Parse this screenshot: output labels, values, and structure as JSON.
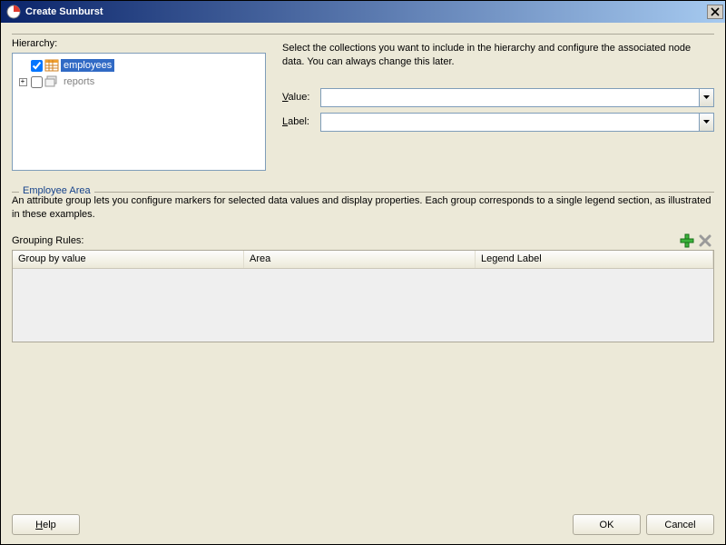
{
  "titlebar": {
    "title": "Create Sunburst"
  },
  "hierarchy": {
    "label": "Hierarchy:",
    "nodes": {
      "employees": "employees",
      "reports": "reports"
    }
  },
  "instruction": "Select the collections you want to include in the hierarchy and configure the associated node data. You can always change this later.",
  "fields": {
    "value_label": "Value:",
    "value_mn": "V",
    "label_label": "Label:",
    "label_mn": "L",
    "value_value": "",
    "label_value": ""
  },
  "employee_area": {
    "legend": "Employee Area",
    "desc": "An attribute group lets you configure markers for selected data values and display properties. Each group corresponds to a single legend section, as illustrated in these examples.",
    "rules_label": "Grouping Rules:",
    "columns": {
      "group_by": "Group by value",
      "area": "Area",
      "legend": "Legend Label"
    }
  },
  "buttons": {
    "help": "Help",
    "ok": "OK",
    "cancel": "Cancel"
  }
}
